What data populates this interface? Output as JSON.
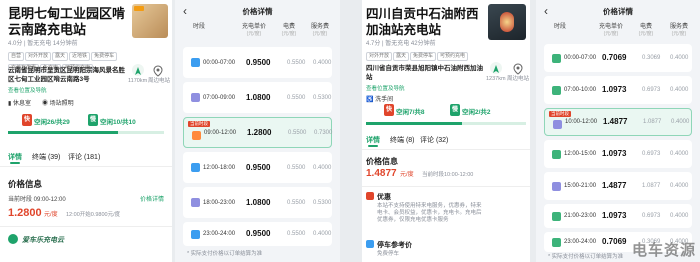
{
  "colors": {
    "green": "#1ea36b",
    "red": "#e0452b",
    "slow_icon": "#3db37a",
    "mid_icon": "#8f8fe0",
    "peak_icon": "#ff8a3c",
    "valley_icon": "#3b9df0"
  },
  "s1": {
    "title": "昆明七甸工业园区啃云南路充电站",
    "rating": "4.0分 | 暂无充电 14分钟前",
    "tags": [
      "自营",
      "对外开放",
      "露天",
      "近地铁",
      "免费停车",
      "充值有优惠",
      "免充电",
      "可预约充电"
    ],
    "address": "云南省昆明市呈贡区昆明阳宗海风景名胜区七甸工业园区啃云南路3号",
    "address_link": "查看位置及导航",
    "dist": "1170km",
    "nav_label": "周边电站",
    "amenities": [
      "休息室",
      "场站照明"
    ],
    "fast_label": "空闲26/共29",
    "slow_label": "空闲10/共10",
    "tabs": [
      "详情",
      "终端 (39)",
      "评论 (181)"
    ],
    "price_title": "价格信息",
    "price_period": "当前时段 09:00-12:00",
    "price_link": "价格详情",
    "price_value": "1.2800",
    "price_unit": "元/度",
    "price_hint": "12:00开始0.9800元/度",
    "bottom_logo": "爱车乐充电云"
  },
  "s2": {
    "back": "‹",
    "title": "价格详情",
    "headers": [
      {
        "label": "时段",
        "sub": ""
      },
      {
        "label": "充电单价",
        "sub": "(元/度)"
      },
      {
        "label": "电费",
        "sub": "(元/度)"
      },
      {
        "label": "服务费",
        "sub": "(元/度)"
      }
    ],
    "rows": [
      {
        "time": "00:00-07:00",
        "price": "0.9500",
        "elec": "0.5500",
        "svc": "0.4000",
        "kind": "valley",
        "selected": false
      },
      {
        "time": "07:00-09:00",
        "price": "1.0800",
        "elec": "0.5500",
        "svc": "0.5300",
        "kind": "mid",
        "selected": false
      },
      {
        "time": "09:00-12:00",
        "price": "1.2800",
        "elec": "0.5500",
        "svc": "0.7300",
        "kind": "peak",
        "selected": true,
        "tag": "当前时段"
      },
      {
        "time": "12:00-18:00",
        "price": "0.9500",
        "elec": "0.5500",
        "svc": "0.4000",
        "kind": "valley",
        "selected": false
      },
      {
        "time": "18:00-23:00",
        "price": "1.0800",
        "elec": "0.5500",
        "svc": "0.5300",
        "kind": "mid",
        "selected": false
      },
      {
        "time": "23:00-24:00",
        "price": "0.9500",
        "elec": "0.5500",
        "svc": "0.4000",
        "kind": "valley",
        "selected": false
      }
    ],
    "footnote": "* 实际支付价格以订单结算为准"
  },
  "s3": {
    "title": "四川自贡中石油附西加油站充电站",
    "rating": "4.7分 | 暂无充电 42分钟前",
    "tags": [
      "对外开放",
      "露天",
      "免费停车",
      "可预约充电"
    ],
    "address": "四川省自贡市荣县旭阳镇中石油附西加油站",
    "address_link": "查看位置及导航",
    "dist": "1237km",
    "nav_label": "周边电站",
    "amenity": "洗手间",
    "fast_label": "空闲7/共8",
    "slow_label": "空闲2/共2",
    "tabs": [
      "详情",
      "终端 (8)",
      "评论 (32)"
    ],
    "price_title": "价格信息",
    "price_value": "1.4877",
    "price_unit": "元/度",
    "price_hint": "当前时段10:00-12:00",
    "offer_title": "优惠",
    "offer_text": "本站不支持使用特来电服务，优惠券，特来电卡、会员权益，优惠卡，充电卡。充电后优惠券，仅限充电优惠卡服务",
    "parking_title": "停车参考价",
    "parking_text": "免费停车"
  },
  "s4": {
    "back": "‹",
    "title": "价格详情",
    "headers": [
      {
        "label": "时段",
        "sub": ""
      },
      {
        "label": "充电单价",
        "sub": "(元/度)"
      },
      {
        "label": "电费",
        "sub": "(元/度)"
      },
      {
        "label": "服务费",
        "sub": "(元/度)"
      }
    ],
    "rows": [
      {
        "time": "00:00-07:00",
        "price": "0.7069",
        "elec": "0.3069",
        "svc": "0.4000",
        "kind": "slow",
        "selected": false
      },
      {
        "time": "07:00-10:00",
        "price": "1.0973",
        "elec": "0.6973",
        "svc": "0.4000",
        "kind": "slow",
        "selected": false
      },
      {
        "time": "10:00-12:00",
        "price": "1.4877",
        "elec": "1.0877",
        "svc": "0.4000",
        "kind": "mid",
        "selected": true,
        "tag": "当前时段"
      },
      {
        "time": "12:00-15:00",
        "price": "1.0973",
        "elec": "0.6973",
        "svc": "0.4000",
        "kind": "slow",
        "selected": false
      },
      {
        "time": "15:00-21:00",
        "price": "1.4877",
        "elec": "1.0877",
        "svc": "0.4000",
        "kind": "mid",
        "selected": false
      },
      {
        "time": "21:00-23:00",
        "price": "1.0973",
        "elec": "0.6973",
        "svc": "0.4000",
        "kind": "slow",
        "selected": false
      },
      {
        "time": "23:00-24:00",
        "price": "0.7069",
        "elec": "0.3069",
        "svc": "0.4000",
        "kind": "slow",
        "selected": false
      }
    ],
    "footnote": "* 实际支付价格以订单结算为准",
    "watermark": "电车资源"
  }
}
